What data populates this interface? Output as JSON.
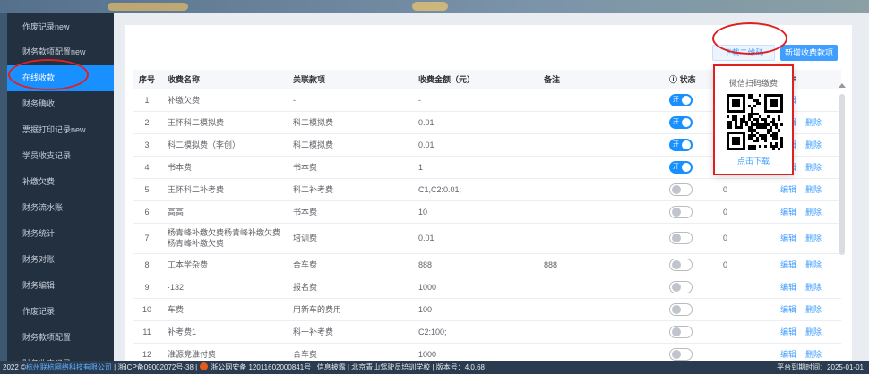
{
  "sidebar": {
    "items": [
      {
        "label": "作废记录new",
        "active": false
      },
      {
        "label": "财务款项配置new",
        "active": false
      },
      {
        "label": "在线收款",
        "active": true
      },
      {
        "label": "财务确收",
        "active": false
      },
      {
        "label": "票据打印记录new",
        "active": false
      },
      {
        "label": "学员收支记录",
        "active": false
      },
      {
        "label": "补缴欠费",
        "active": false
      },
      {
        "label": "财务流水账",
        "active": false
      },
      {
        "label": "财务统计",
        "active": false
      },
      {
        "label": "财务对账",
        "active": false
      },
      {
        "label": "财务编辑",
        "active": false
      },
      {
        "label": "作废记录",
        "active": false
      },
      {
        "label": "财务款项配置",
        "active": false
      },
      {
        "label": "财务收支记录",
        "active": false
      }
    ]
  },
  "toolbar": {
    "qr_button": "下载二维码",
    "new_button": "新增收费款项"
  },
  "table": {
    "headers": {
      "index": "序号",
      "name": "收费名称",
      "related": "关联款项",
      "amount": "收费金额（元）",
      "remark": "备注",
      "status": "ⓘ 状态",
      "sort": "",
      "ops": "操作"
    },
    "edit_label": "编辑",
    "delete_label": "删除",
    "on_label": "开",
    "off_label": "关",
    "rows": [
      {
        "idx": "1",
        "name": "补缴欠费",
        "related": "-",
        "amount": "-",
        "remark": "",
        "status": "on",
        "sort": "",
        "del": false
      },
      {
        "idx": "2",
        "name": "王怀科二模拟费",
        "related": "科二模拟费",
        "amount": "0.01",
        "remark": "",
        "status": "on",
        "sort": "",
        "del": true
      },
      {
        "idx": "3",
        "name": "科二模拟费（李创）",
        "related": "科二模拟费",
        "amount": "0.01",
        "remark": "",
        "status": "on",
        "sort": "",
        "del": true
      },
      {
        "idx": "4",
        "name": "书本费",
        "related": "书本费",
        "amount": "1",
        "remark": "",
        "status": "on",
        "sort": "",
        "del": true
      },
      {
        "idx": "5",
        "name": "王怀科二补考费",
        "related": "科二补考费",
        "amount": "C1,C2:0.01;",
        "remark": "",
        "status": "off",
        "sort": "0",
        "del": true
      },
      {
        "idx": "6",
        "name": "高高",
        "related": "书本费",
        "amount": "10",
        "remark": "",
        "status": "off",
        "sort": "0",
        "del": true
      },
      {
        "idx": "7",
        "name": "杨青峰补缴欠费杨青峰补缴欠费杨青峰补缴欠费",
        "related": "培训费",
        "amount": "0.01",
        "remark": "",
        "status": "off",
        "sort": "0",
        "del": true,
        "tall": true
      },
      {
        "idx": "8",
        "name": "工本学杂费",
        "related": "合车费",
        "amount": "888",
        "remark": "888",
        "status": "off",
        "sort": "0",
        "del": true
      },
      {
        "idx": "9",
        "name": "·132",
        "related": "报名费",
        "amount": "1000",
        "remark": "",
        "status": "off",
        "sort": "",
        "del": true
      },
      {
        "idx": "10",
        "name": "车费",
        "related": "用新车的费用",
        "amount": "100",
        "remark": "",
        "status": "off",
        "sort": "",
        "del": true
      },
      {
        "idx": "11",
        "name": "补考费1",
        "related": "科一补考费",
        "amount": "C2:100;",
        "remark": "",
        "status": "off",
        "sort": "",
        "del": true
      },
      {
        "idx": "12",
        "name": "淮源竞淮付费",
        "related": "合车费",
        "amount": "1000",
        "remark": "",
        "status": "off",
        "sort": "",
        "del": true
      },
      {
        "idx": "13",
        "name": "",
        "related": "",
        "amount": "",
        "remark": "",
        "status": "off",
        "sort": "",
        "del": true
      }
    ]
  },
  "popover": {
    "title": "微信扫码缴费",
    "download_label": "点击下载"
  },
  "footer": {
    "prefix": "2022 ©",
    "company": "杭州联杭网络科技有限公司",
    "icp": "| 浙ICP备09002072号-38 |",
    "police": "浙公网安备 12011602000841号 | 信息披露 | 北京青山驾驶员培训学校 | 版本号：4.0.68",
    "expire": "平台到期时间：2025-01-01"
  },
  "colors": {
    "accent": "#1890ff",
    "annotation": "#e02020"
  }
}
